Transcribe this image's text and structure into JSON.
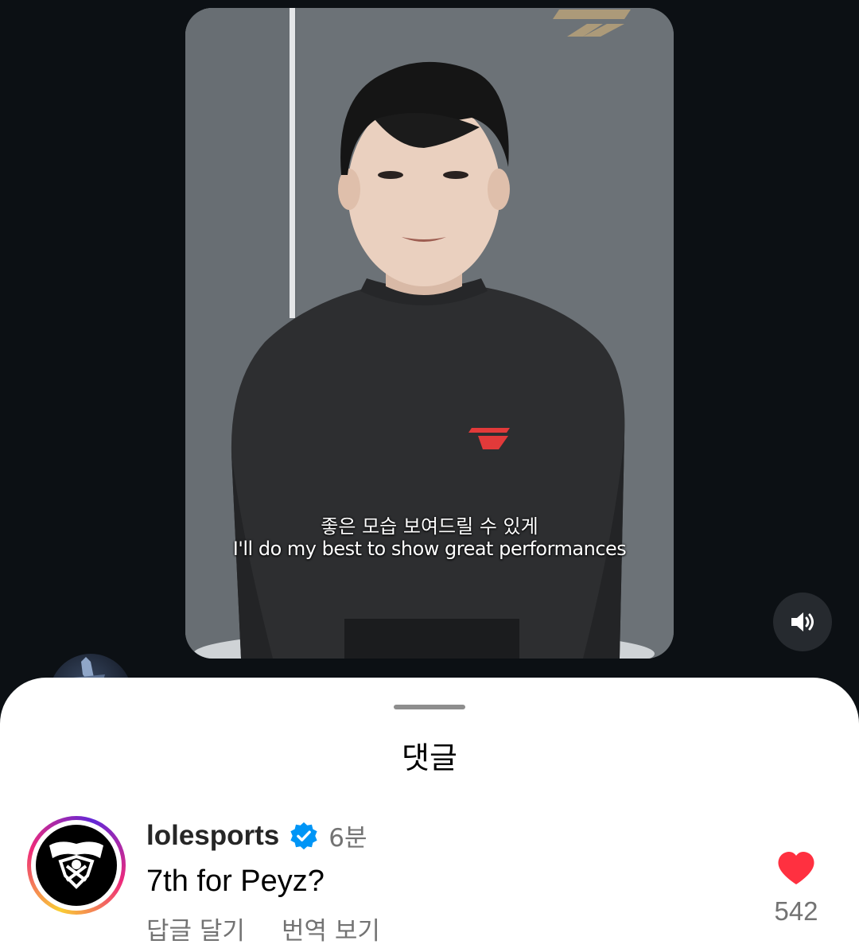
{
  "video": {
    "caption_ko": "좋은 모습 보여드릴 수 있게",
    "caption_en": "I'll do my best to show great performances",
    "mute_icon": "speaker-volume-icon"
  },
  "sheet": {
    "title": "댓글"
  },
  "comment": {
    "username": "lolesports",
    "verified_icon": "verified-badge-icon",
    "time": "6분",
    "text": "7th for Peyz?",
    "reply_label": "답글 달기",
    "translate_label": "번역 보기",
    "like_icon": "heart-filled-icon",
    "like_count": "542"
  },
  "colors": {
    "background": "#0c1014",
    "like": "#ff3040",
    "verified": "#0095f6",
    "secondary_text": "#737373"
  }
}
